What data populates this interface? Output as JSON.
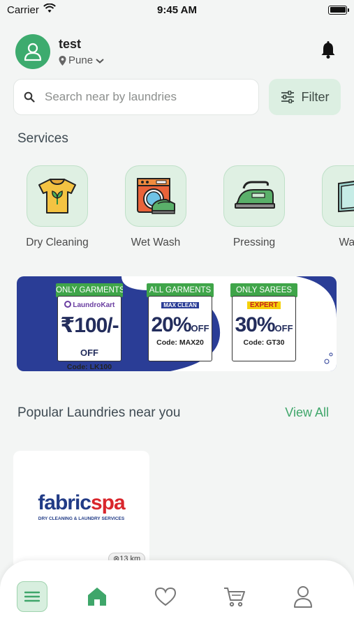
{
  "status_bar": {
    "carrier": "Carrier",
    "time": "9:45 AM"
  },
  "header": {
    "user_name": "test",
    "location": "Pune"
  },
  "search": {
    "placeholder": "Search near by laundries",
    "filter_label": "Filter"
  },
  "services": {
    "title": "Services",
    "items": [
      {
        "label": "Dry Cleaning",
        "icon": "tshirt-icon"
      },
      {
        "label": "Wet Wash",
        "icon": "washing-machine-icon"
      },
      {
        "label": "Pressing",
        "icon": "iron-icon"
      },
      {
        "label": "Wash",
        "icon": "folded-clothes-icon"
      }
    ]
  },
  "offers": [
    {
      "tag": "ONLY GARMENTS",
      "brand": "LaundroKart",
      "value": "₹100/-",
      "suffix": "OFF",
      "code": "Code: LK100"
    },
    {
      "tag": "ALL GARMENTS",
      "brand": "MAX CLEAN",
      "value": "20%",
      "suffix": "OFF",
      "code": "Code: MAX20"
    },
    {
      "tag": "ONLY SAREES",
      "brand": "EXPERT",
      "value": "30%",
      "suffix": "OFF",
      "code": "Code: GT30"
    }
  ],
  "popular": {
    "title": "Popular Laundries near you",
    "view_all": "View All",
    "cards": [
      {
        "brand_part1": "fabric",
        "brand_part2": "spa",
        "tagline": "DRY CLEANING & LAUNDRY SERVICES",
        "distance": "13 km"
      }
    ]
  },
  "colors": {
    "accent": "#3dab6e",
    "banner": "#2a3d96",
    "tile_bg": "#dff0e3"
  },
  "bottom_nav": {
    "items": [
      {
        "icon": "menu-icon",
        "active": false
      },
      {
        "icon": "home-icon",
        "active": true
      },
      {
        "icon": "heart-icon",
        "active": false
      },
      {
        "icon": "cart-icon",
        "active": false
      },
      {
        "icon": "profile-icon",
        "active": false
      }
    ]
  }
}
